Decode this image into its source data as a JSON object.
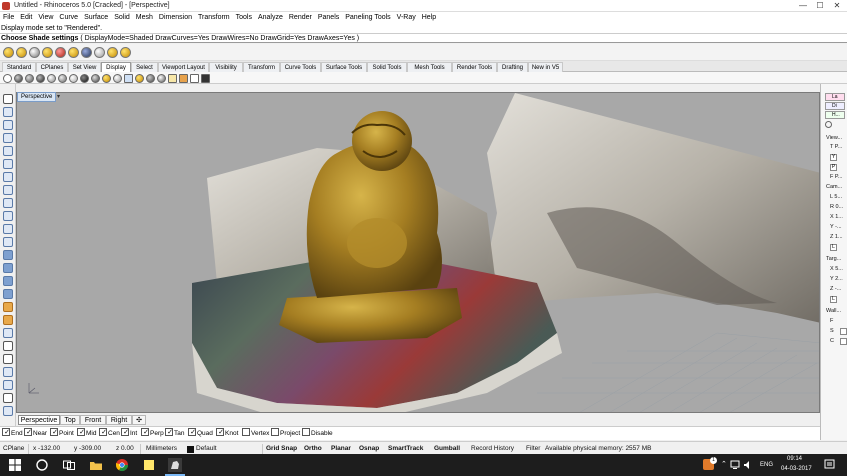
{
  "window": {
    "title": "Untitled - Rhinoceros 5.0 [Cracked] - [Perspective]",
    "min": "—",
    "max": "☐",
    "close": "✕"
  },
  "menu": [
    "File",
    "Edit",
    "View",
    "Curve",
    "Surface",
    "Solid",
    "Mesh",
    "Dimension",
    "Transform",
    "Tools",
    "Analyze",
    "Render",
    "Panels",
    "Paneling Tools",
    "V-Ray",
    "Help"
  ],
  "command": {
    "history": "Display mode set to \"Rendered\".",
    "prompt": "Choose Shade settings",
    "options": "( DisplayMode=Shaded  DrawCurves=Yes  DrawWires=No  DrawGrid=Yes  DrawAxes=Yes )"
  },
  "toolbar_tabs": [
    "Standard",
    "CPlanes",
    "Set View",
    "Display",
    "Select",
    "Viewport Layout",
    "Visibility",
    "Transform",
    "Curve Tools",
    "Surface Tools",
    "Solid Tools",
    "Mesh Tools",
    "Render Tools",
    "Drafting",
    "New in V5"
  ],
  "active_toolbar_tab": "Display",
  "viewport": {
    "label": "Perspective",
    "dropdown": "▾"
  },
  "viewport_tabs": [
    "Perspective",
    "Top",
    "Front",
    "Right",
    "✣"
  ],
  "osnaps": [
    {
      "label": "End",
      "on": true
    },
    {
      "label": "Near",
      "on": true
    },
    {
      "label": "Point",
      "on": true
    },
    {
      "label": "Mid",
      "on": true
    },
    {
      "label": "Cen",
      "on": true
    },
    {
      "label": "Int",
      "on": true
    },
    {
      "label": "Perp",
      "on": true
    },
    {
      "label": "Tan",
      "on": true
    },
    {
      "label": "Quad",
      "on": true
    },
    {
      "label": "Knot",
      "on": true
    },
    {
      "label": "Vertex",
      "on": false
    },
    {
      "label": "Project",
      "on": false
    },
    {
      "label": "Disable",
      "on": false
    }
  ],
  "status": {
    "cplane": "CPlane",
    "x": "x -132.00",
    "y": "y -309.00",
    "z": "z 0.00",
    "units": "Millimeters",
    "layer": "Default",
    "grid_snap": "Grid Snap",
    "ortho": "Ortho",
    "planar": "Planar",
    "osnap": "Osnap",
    "smarttrack": "SmartTrack",
    "gumball": "Gumball",
    "record_history": "Record History",
    "filter": "Filter",
    "memory": "Available physical memory: 2557 MB"
  },
  "right_panel": {
    "view_header": "View...",
    "view_items": [
      "T",
      "P..."
    ],
    "view_boxes": [
      "Y",
      "P"
    ],
    "camera_header": "Cam...",
    "camera_items": [
      "L",
      "5...",
      "R",
      "0...",
      "X",
      "1...",
      "Y",
      "-...",
      "Z",
      "1...",
      "L"
    ],
    "target_header": "Targ...",
    "target_items": [
      "X",
      "5...",
      "Y",
      "2...",
      "Z",
      "-...",
      "L"
    ],
    "wall_header": "Wall...",
    "wall_items": [
      "F",
      "S",
      "C"
    ],
    "tabs": [
      "La",
      "Di",
      "H..."
    ]
  },
  "taskbar": {
    "language": "ENG",
    "time": "09:14",
    "date": "04-03-2017",
    "notif_badge": "1"
  }
}
